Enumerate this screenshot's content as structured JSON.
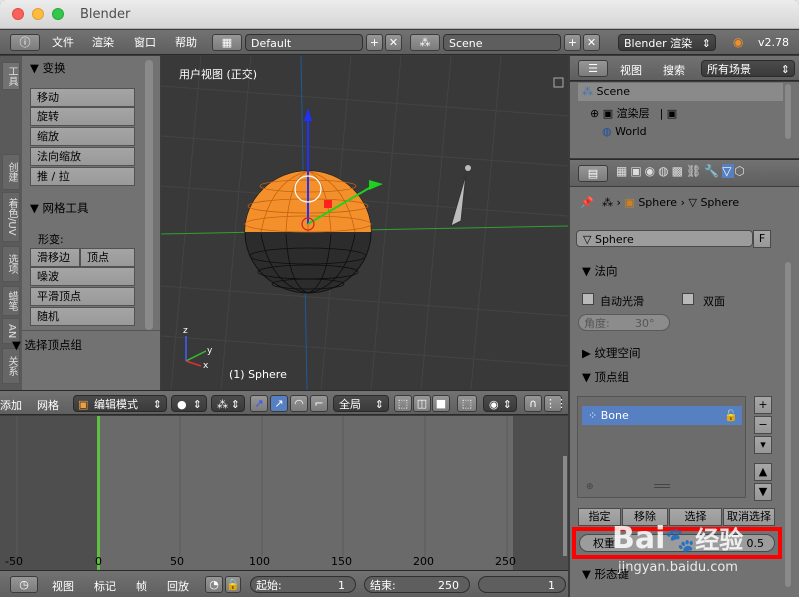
{
  "window": {
    "title": "Blender"
  },
  "top_menu": {
    "items": [
      "文件",
      "渲染",
      "窗口",
      "帮助"
    ],
    "layout": "Default",
    "scene": "Scene",
    "engine": "Blender 渲染",
    "version": "v2.78"
  },
  "tool_tabs": [
    "工具",
    "创建",
    "着色/UV",
    "选项",
    "蜡笔",
    "AN",
    "关系"
  ],
  "toolshelf": {
    "transform_header": "▼ 变换",
    "transform_buttons": [
      "移动",
      "旋转",
      "缩放",
      "法向缩放",
      "推 / 拉"
    ],
    "mesh_tools_header": "▼ 网格工具",
    "deform_label": "形变:",
    "deform_row": [
      "滑移边",
      "顶点"
    ],
    "deform_buttons": [
      "噪波",
      "平滑顶点",
      "随机"
    ],
    "select_vgroup_header": "▼ 选择顶点组"
  },
  "viewport": {
    "title": "用户视图 (正交)",
    "object_label": "(1) Sphere",
    "axis_z": "z",
    "axis_y": "y",
    "axis_x": "x"
  },
  "view_header": {
    "cut_label": "添加",
    "mesh_label": "网格",
    "mode": "编辑模式",
    "pivot": "全局"
  },
  "timeline": {
    "ticks": [
      "-50",
      "0",
      "50",
      "100",
      "150",
      "200",
      "250"
    ]
  },
  "timeline_header": {
    "items": [
      "视图",
      "标记",
      "帧",
      "回放"
    ],
    "start_label": "起始:",
    "start_value": "1",
    "end_label": "结束:",
    "end_value": "250",
    "current": "1"
  },
  "outliner": {
    "view_label": "视图",
    "search_label": "搜索",
    "filter": "所有场景",
    "rows": [
      "Scene",
      "渲染层",
      "World"
    ]
  },
  "properties": {
    "breadcrumb_obj": "Sphere",
    "breadcrumb_data": "Sphere",
    "mesh_name": "Sphere",
    "f_label": "F",
    "normals_header": "▼ 法向",
    "auto_smooth": "自动光滑",
    "double_sided": "双面",
    "angle_label": "角度:",
    "angle_value": "30°",
    "texture_space": "▶ 纹理空间",
    "vertex_groups": "▼ 顶点组",
    "group_name": "Bone",
    "buttons": [
      "指定",
      "移除",
      "选择",
      "取消选择"
    ],
    "weight_label": "权重",
    "weight_value": "0.5",
    "shape_keys": "▼ 形态键"
  },
  "watermark": {
    "brand": "Bai",
    "brand_suffix": "经验",
    "url": "jingyan.baidu.com"
  },
  "colors": {
    "selection_orange": "#f3902c",
    "highlight_red": "#ff0000",
    "list_blue": "#5680c2",
    "timeline_green": "#60c040"
  }
}
